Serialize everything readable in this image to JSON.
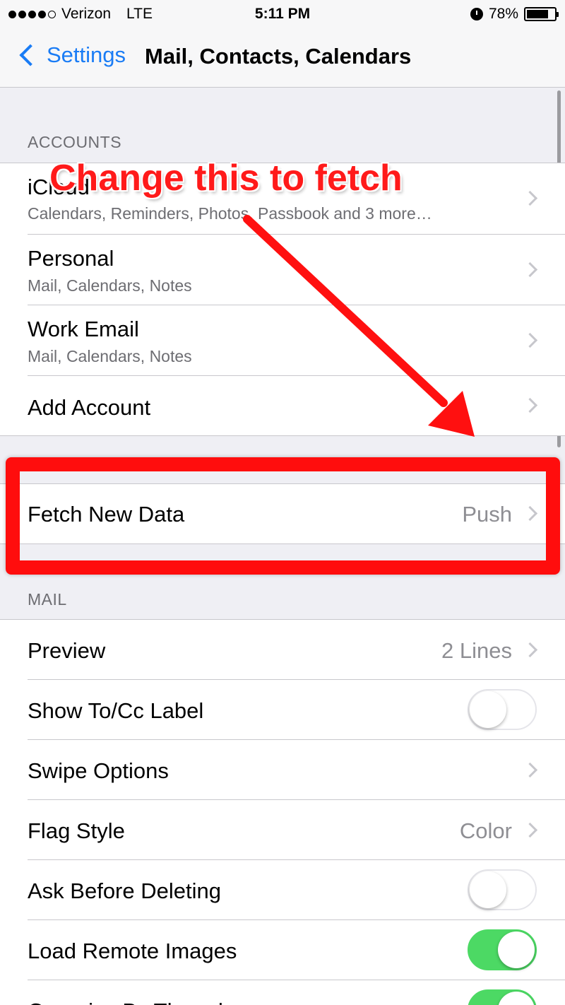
{
  "status_bar": {
    "carrier": "Verizon",
    "network": "LTE",
    "time": "5:11 PM",
    "battery": "78%",
    "battery_level": 0.78
  },
  "nav": {
    "back_label": "Settings",
    "title": "Mail, Contacts, Calendars"
  },
  "accounts": {
    "header": "ACCOUNTS",
    "items": [
      {
        "title": "iCloud",
        "subtitle": "Calendars, Reminders, Photos, Passbook and 3 more…"
      },
      {
        "title": "Personal",
        "subtitle": "Mail, Calendars, Notes"
      },
      {
        "title": "Work Email",
        "subtitle": "Mail, Calendars, Notes"
      },
      {
        "title": "Add Account"
      }
    ]
  },
  "fetch": {
    "title": "Fetch New Data",
    "value": "Push"
  },
  "mail": {
    "header": "MAIL",
    "items": [
      {
        "title": "Preview",
        "value": "2 Lines"
      },
      {
        "title": "Show To/Cc Label",
        "toggle": false
      },
      {
        "title": "Swipe Options"
      },
      {
        "title": "Flag Style",
        "value": "Color"
      },
      {
        "title": "Ask Before Deleting",
        "toggle": false
      },
      {
        "title": "Load Remote Images",
        "toggle": true
      },
      {
        "title": "Organize By Thread",
        "toggle": true
      }
    ]
  },
  "annotation": {
    "text": "Change this to fetch",
    "color": "#ff1a1a"
  },
  "colors": {
    "accent": "#1a7cf5",
    "toggle_on": "#4cd964",
    "background": "#efeff4"
  }
}
